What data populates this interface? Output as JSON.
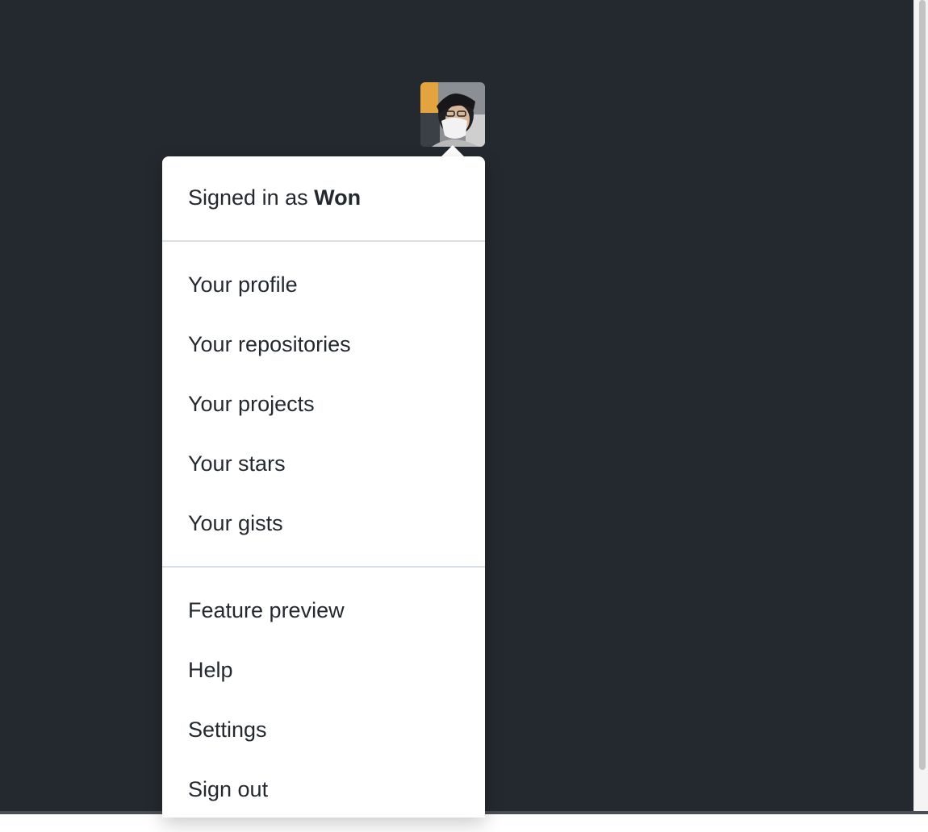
{
  "header": {
    "signed_in_prefix": "Signed in as",
    "username": "Won"
  },
  "avatar": {
    "alt": "@Won"
  },
  "menu": {
    "group1": [
      {
        "label": "Your profile"
      },
      {
        "label": "Your repositories"
      },
      {
        "label": "Your projects"
      },
      {
        "label": "Your stars"
      },
      {
        "label": "Your gists"
      }
    ],
    "group2": [
      {
        "label": "Feature preview"
      },
      {
        "label": "Help"
      },
      {
        "label": "Settings"
      },
      {
        "label": "Sign out"
      }
    ]
  },
  "colors": {
    "header_background": "#24292f",
    "dropdown_background": "#ffffff",
    "text": "#24292f",
    "divider": "#d8dee4"
  }
}
